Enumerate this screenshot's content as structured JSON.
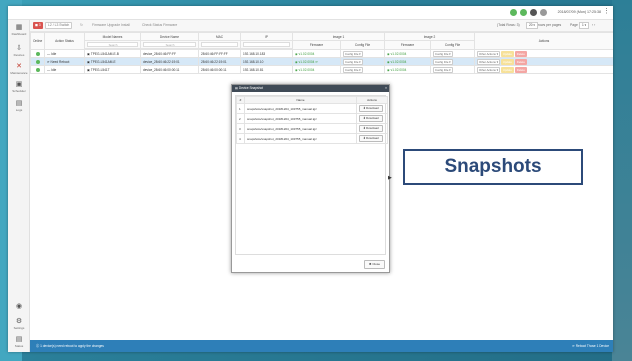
{
  "topbar": {
    "datetime": "2018/07/09 (Mon) 17:25:38",
    "status_colors": [
      "#5cb85c",
      "#5cb85c",
      "#555555",
      "#999999"
    ]
  },
  "nav": [
    {
      "icon": "dashboard-icon",
      "glyph": "▦",
      "label": "Dashboard"
    },
    {
      "icon": "devices-icon",
      "glyph": "⇩",
      "label": "Devices"
    },
    {
      "icon": "maintenance-icon",
      "glyph": "✕",
      "label": "Maintenance"
    },
    {
      "icon": "scheduler-icon",
      "glyph": "▣",
      "label": "Scheduler"
    },
    {
      "icon": "logs-icon",
      "glyph": "▤",
      "label": "Logs"
    },
    {
      "icon": "profile-icon",
      "glyph": "◉",
      "label": ""
    },
    {
      "icon": "settings-icon",
      "glyph": "⚙",
      "label": "Settings"
    },
    {
      "icon": "status-icon",
      "glyph": "▤",
      "label": "Status"
    }
  ],
  "toolbar": {
    "delete_label": "◼ 3",
    "switch_label": "L2 / L3 Switch",
    "btn3": "↻",
    "btn4": "Firmware Upgrade Install",
    "btn5": "Check Status Firmware",
    "total_label": "(Total Rows: 3)",
    "per_page": "20 ▾",
    "per_page_label": "rows per pages",
    "page_label": "Page",
    "page_value": "1 ▾",
    "nav": "‹ ›"
  },
  "table": {
    "group_headers": {
      "image1": "Image 1",
      "image2": "Image 2",
      "actions": "Actions"
    },
    "headers": [
      "Online",
      "Action Status",
      "Model Names",
      "Device Name",
      "MAC",
      "IP",
      "Firmware",
      "Config File",
      "Firmware",
      "Config File"
    ],
    "filters": {
      "model": "Search",
      "device": "Search"
    },
    "rows": [
      {
        "status": "— Idle",
        "model": "▣ TPEG-L541AM-E-B",
        "device": "device_28:60:46:FF:FF",
        "mac": "28:60:46:FF:FF:FF",
        "ip": "192.168.10.183",
        "fw1": "◉ v1.02.0004",
        "cfg1": "Config File ▾",
        "fw2": "◉ v1.02.0004",
        "cfg2": "Config File ▾",
        "action": "Other Actions ▾",
        "b1": "Update",
        "b2": "Delete"
      },
      {
        "status": "⟳ Need Reboot",
        "model": "▣ TPEG-L541AM-E",
        "device": "device_28:60:46:22:19:01",
        "mac": "28:60:46:22:19:01",
        "ip": "192.168.10.10",
        "fw1": "◉ v1.02.0004 ⟳",
        "cfg1": "Config File ▾",
        "fw2": "◉ v1.02.0004",
        "cfg2": "Config File ▾",
        "action": "Other Actions ▾",
        "b1": "Update",
        "b2": "Delete"
      },
      {
        "status": "— Idle",
        "model": "▣ TPEG-L541T",
        "device": "device_28:60:46:00:00:11",
        "mac": "28:60:46:00:00:11",
        "ip": "192.168.10.81",
        "fw1": "◉ v1.02.0004",
        "cfg1": "Config File ▾",
        "fw2": "◉ v1.02.0004",
        "cfg2": "Config File ▾",
        "action": "Other Actions ▾",
        "b1": "Update",
        "b2": "Delete"
      }
    ]
  },
  "modal": {
    "title": "▤ Device Snapshot",
    "close_x": "×",
    "headers": [
      "#",
      "Name",
      "Actions"
    ],
    "rows": [
      {
        "n": "1",
        "name": "snapshots/snapshot_20181204_103755_manual.tgz",
        "action": "⬇ Download"
      },
      {
        "n": "2",
        "name": "snapshots/snapshot_20181204_103755_manual.tgz",
        "action": "⬇ Download"
      },
      {
        "n": "3",
        "name": "snapshots/snapshot_20181204_103755_manual.tgz",
        "action": "⬇ Download"
      },
      {
        "n": "4",
        "name": "snapshots/snapshot_20181204_103755_manual.tgz",
        "action": "⬇ Download"
      }
    ],
    "close_label": "✖ Close"
  },
  "footer": {
    "message": "⓵ 1 device(s) need reboot to apply the changes",
    "right": "⟳ Reboot Those 1 Device"
  },
  "annotation": {
    "label": "Snapshots",
    "border": "#2c4a79"
  }
}
